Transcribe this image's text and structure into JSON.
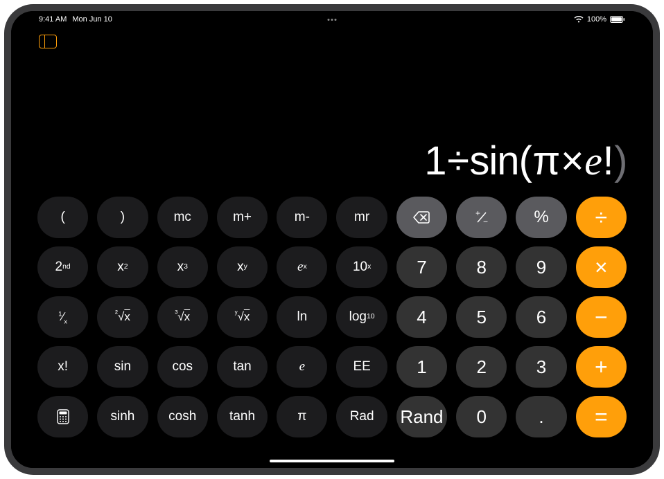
{
  "status": {
    "time": "9:41 AM",
    "date": "Mon Jun 10",
    "battery_pct": "100%"
  },
  "display": {
    "expression_parts": [
      "1",
      "÷",
      "sin",
      "(",
      "π",
      "×",
      "e",
      "!",
      ")"
    ]
  },
  "keypad": {
    "rows": [
      [
        {
          "id": "lparen",
          "label": "(",
          "style": "fn"
        },
        {
          "id": "rparen",
          "label": ")",
          "style": "fn"
        },
        {
          "id": "mc",
          "label": "mc",
          "style": "fn"
        },
        {
          "id": "mplus",
          "label": "m+",
          "style": "fn"
        },
        {
          "id": "mminus",
          "label": "m-",
          "style": "fn"
        },
        {
          "id": "mr",
          "label": "mr",
          "style": "fn"
        },
        {
          "id": "backspace",
          "label": "⌫",
          "style": "ctl",
          "icon": "backspace"
        },
        {
          "id": "sign",
          "label": "⁺∕₋",
          "style": "ctl"
        },
        {
          "id": "percent",
          "label": "%",
          "style": "ctl"
        },
        {
          "id": "divide",
          "label": "÷",
          "style": "op"
        }
      ],
      [
        {
          "id": "second",
          "label": "2",
          "sup": "nd",
          "style": "fn"
        },
        {
          "id": "x2",
          "label": "x",
          "sup": "2",
          "style": "fn"
        },
        {
          "id": "x3",
          "label": "x",
          "sup": "3",
          "style": "fn"
        },
        {
          "id": "xy",
          "label": "x",
          "sup": "y",
          "style": "fn"
        },
        {
          "id": "ex",
          "label": "e",
          "sup": "x",
          "style": "fn",
          "italic": true
        },
        {
          "id": "tenx",
          "label": "10",
          "sup": "x",
          "style": "fn"
        },
        {
          "id": "seven",
          "label": "7",
          "style": "num"
        },
        {
          "id": "eight",
          "label": "8",
          "style": "num"
        },
        {
          "id": "nine",
          "label": "9",
          "style": "num"
        },
        {
          "id": "multiply",
          "label": "×",
          "style": "op"
        }
      ],
      [
        {
          "id": "reciprocal",
          "label": "¹∕ₓ",
          "style": "fn"
        },
        {
          "id": "sqrt",
          "label": "²√x",
          "style": "fn",
          "root": true
        },
        {
          "id": "cbrt",
          "label": "³√x",
          "style": "fn",
          "root": true
        },
        {
          "id": "yroot",
          "label": "ʸ√x",
          "style": "fn",
          "root": true
        },
        {
          "id": "ln",
          "label": "ln",
          "style": "fn"
        },
        {
          "id": "log10",
          "label": "log",
          "sub": "10",
          "style": "fn"
        },
        {
          "id": "four",
          "label": "4",
          "style": "num"
        },
        {
          "id": "five",
          "label": "5",
          "style": "num"
        },
        {
          "id": "six",
          "label": "6",
          "style": "num"
        },
        {
          "id": "minus",
          "label": "−",
          "style": "op"
        }
      ],
      [
        {
          "id": "factorial",
          "label": "x!",
          "style": "fn"
        },
        {
          "id": "sin",
          "label": "sin",
          "style": "fn"
        },
        {
          "id": "cos",
          "label": "cos",
          "style": "fn"
        },
        {
          "id": "tan",
          "label": "tan",
          "style": "fn"
        },
        {
          "id": "e",
          "label": "e",
          "style": "fn",
          "italic": true
        },
        {
          "id": "ee",
          "label": "EE",
          "style": "fn"
        },
        {
          "id": "one",
          "label": "1",
          "style": "num"
        },
        {
          "id": "two",
          "label": "2",
          "style": "num"
        },
        {
          "id": "three",
          "label": "3",
          "style": "num"
        },
        {
          "id": "plus",
          "label": "+",
          "style": "op"
        }
      ],
      [
        {
          "id": "mode",
          "label": "",
          "style": "fn",
          "icon": "calculator"
        },
        {
          "id": "sinh",
          "label": "sinh",
          "style": "fn"
        },
        {
          "id": "cosh",
          "label": "cosh",
          "style": "fn"
        },
        {
          "id": "tanh",
          "label": "tanh",
          "style": "fn"
        },
        {
          "id": "pi",
          "label": "π",
          "style": "fn"
        },
        {
          "id": "rad",
          "label": "Rad",
          "style": "fn"
        },
        {
          "id": "rand",
          "label": "Rand",
          "style": "num"
        },
        {
          "id": "zero",
          "label": "0",
          "style": "num"
        },
        {
          "id": "decimal",
          "label": ".",
          "style": "num"
        },
        {
          "id": "equals",
          "label": "=",
          "style": "op"
        }
      ]
    ]
  }
}
